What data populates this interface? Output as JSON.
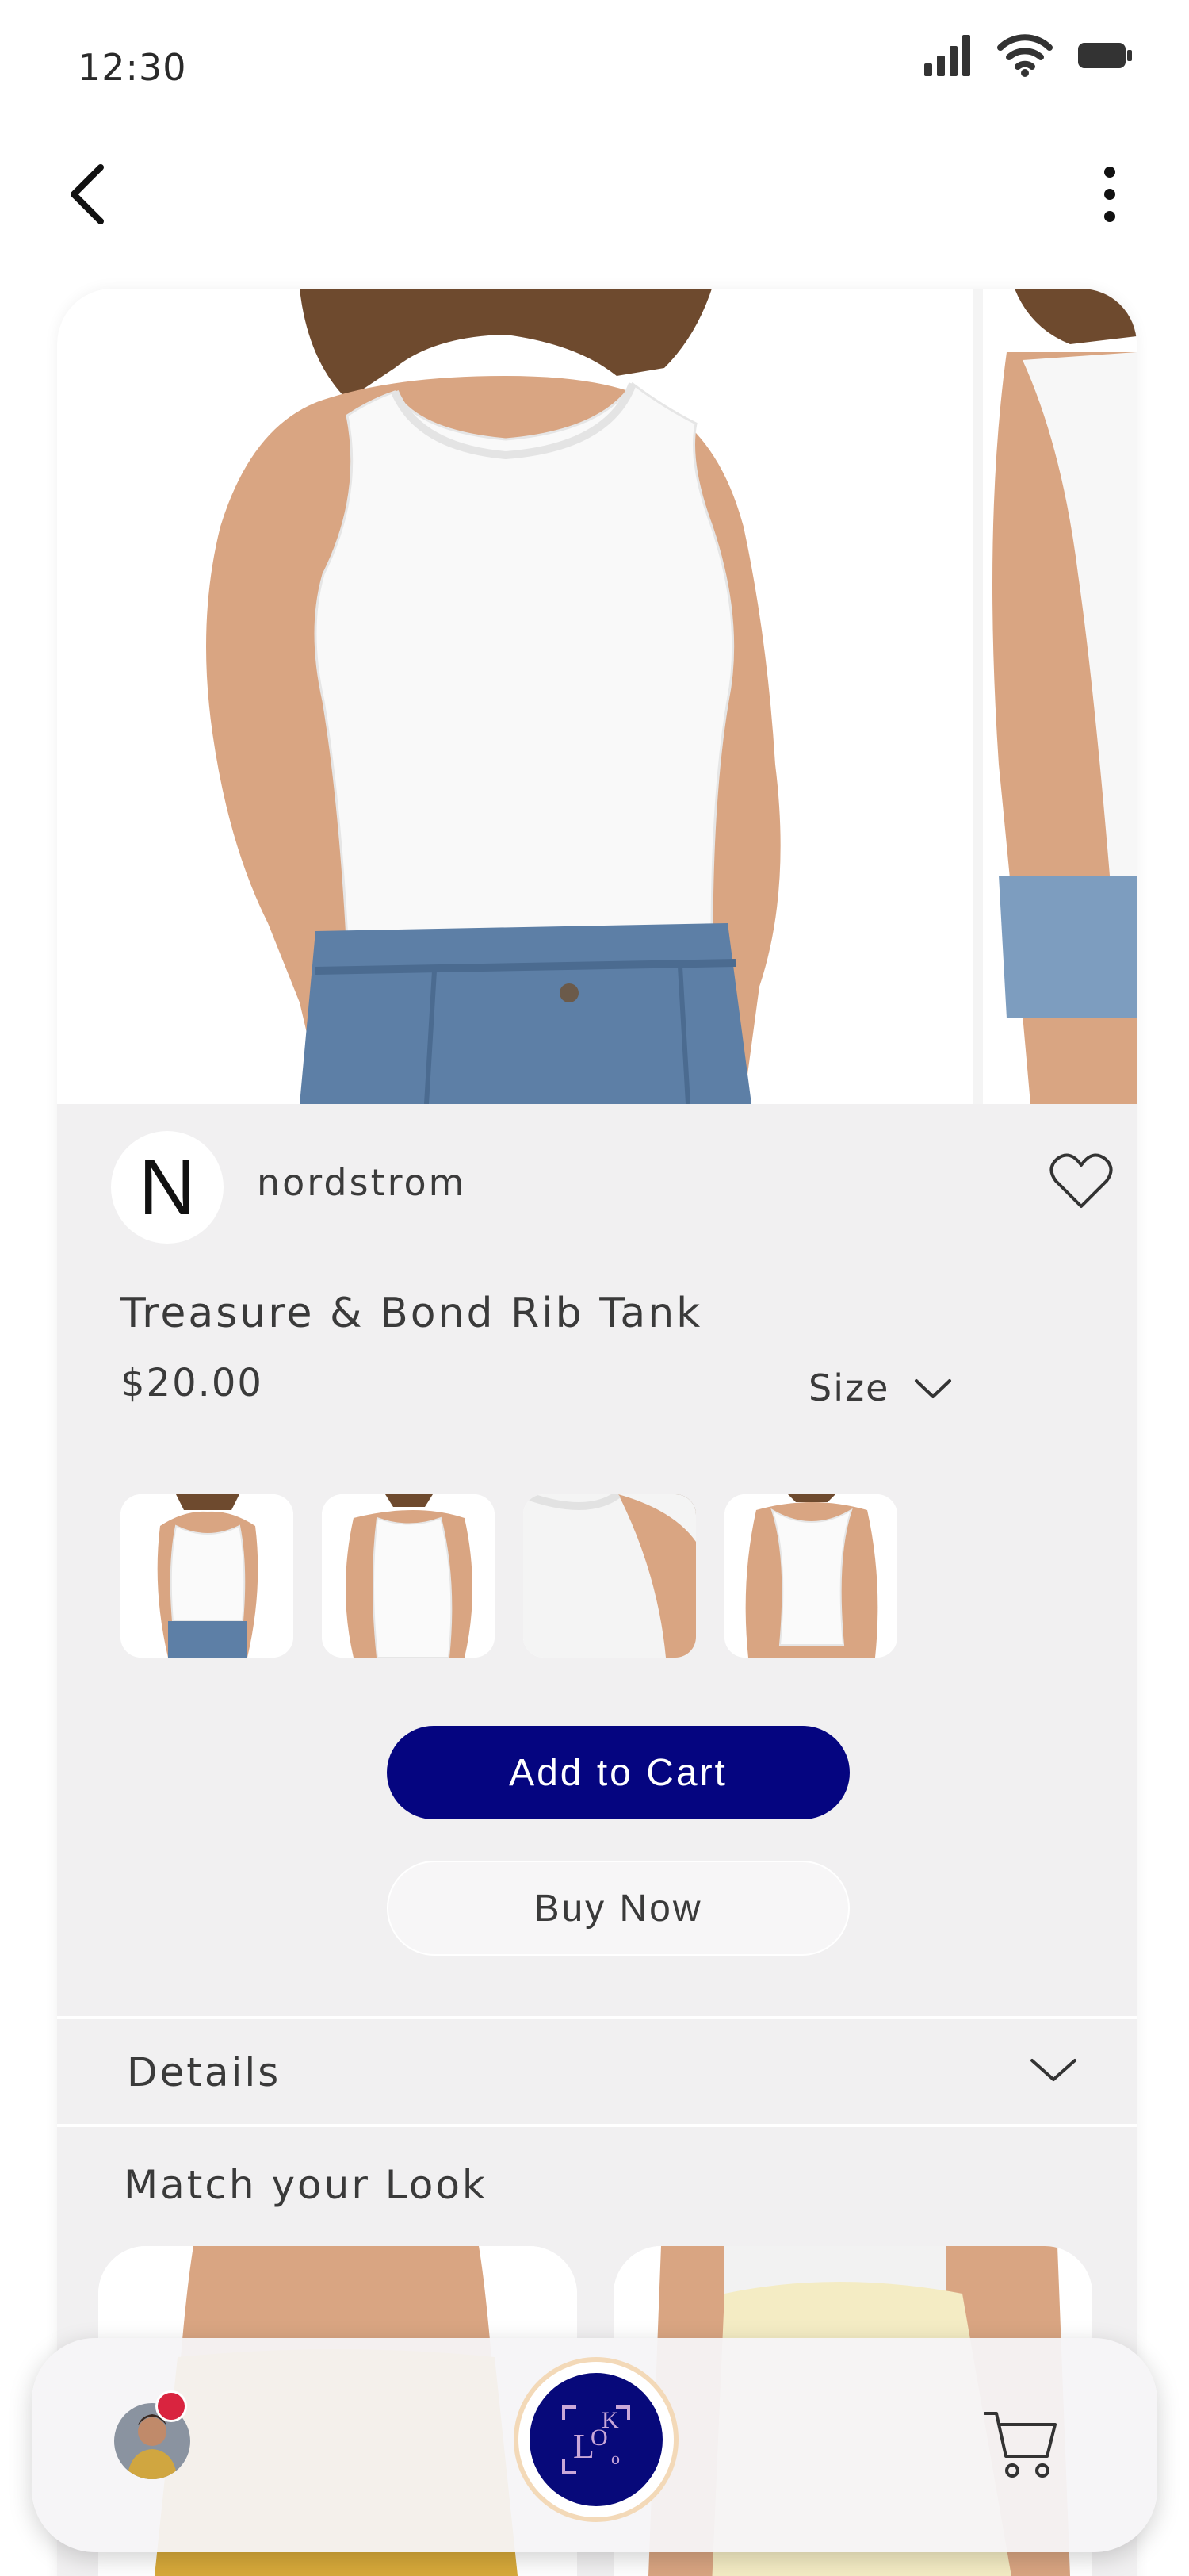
{
  "status_bar": {
    "time": "12:30"
  },
  "header": {
    "back_icon": "chevron-left-icon",
    "more_icon": "kebab-menu-icon"
  },
  "product": {
    "brand_logo_letter": "N",
    "brand_name": "nordstrom",
    "title": "Treasure & Bond Rib Tank",
    "price": "$20.00",
    "size_label": "Size",
    "favorite_icon": "heart-outline-icon",
    "thumbnails": [
      "front",
      "side",
      "neckline",
      "back"
    ]
  },
  "actions": {
    "add_to_cart": "Add to Cart",
    "buy_now": "Buy Now"
  },
  "details": {
    "label": "Details"
  },
  "match": {
    "label": "Match your Look"
  },
  "bottom_nav": {
    "center_logo": "LOOK"
  },
  "colors": {
    "primary_button": "#050580",
    "card_background": "#f1f0f1",
    "badge": "#d9243f"
  }
}
